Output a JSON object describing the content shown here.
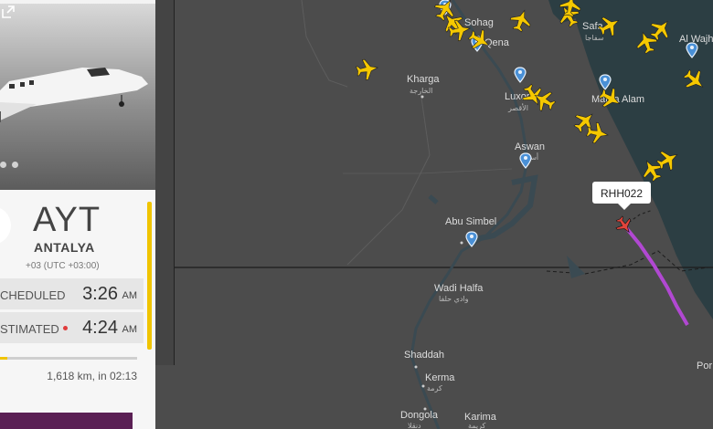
{
  "airport": {
    "code": "AYT",
    "city": "ANTALYA",
    "timezone": "+03 (UTC +03:00)"
  },
  "times": {
    "scheduled_label": "CHEDULED",
    "scheduled_time": "3:26",
    "scheduled_ampm": "AM",
    "estimated_label": "STIMATED",
    "estimated_time": "4:24",
    "estimated_ampm": "AM"
  },
  "distance": "1,618 km, in 02:13",
  "progress_fraction": 0.05,
  "flight": {
    "callsign": "RHH022"
  },
  "map_labels": {
    "sohag": "Sohag",
    "qena": "Qena",
    "safaga": "Safa",
    "safaga_ar": "سفاجا",
    "wajh": "Al Wajh",
    "kharga": "Kharga",
    "kharga_ar": "الخارجة",
    "luxor": "Luxor",
    "luxor_ar": "الأقصر",
    "marsa_alam": "Marsa Alam",
    "aswan": "Aswan",
    "aswan_ar": "أسوان",
    "abu_simbel": "Abu Simbel",
    "wadi_halfa": "Wadi Halfa",
    "wadi_halfa_ar": "وادي حلفا",
    "shaddah": "Shaddah",
    "kerma": "Kerma",
    "kerma_ar": "كرمة",
    "dongola": "Dongola",
    "dongola_ar": "دنقلا",
    "karima": "Karima",
    "karima_ar": "كريمة",
    "port": "Por"
  },
  "colors": {
    "plane": "#f5c800",
    "track": "#b148d2",
    "selected_plane": "#e0443c",
    "progress": "#f0c400"
  },
  "icons": [
    "plane-icon",
    "airport-pin-icon",
    "expand-icon"
  ]
}
